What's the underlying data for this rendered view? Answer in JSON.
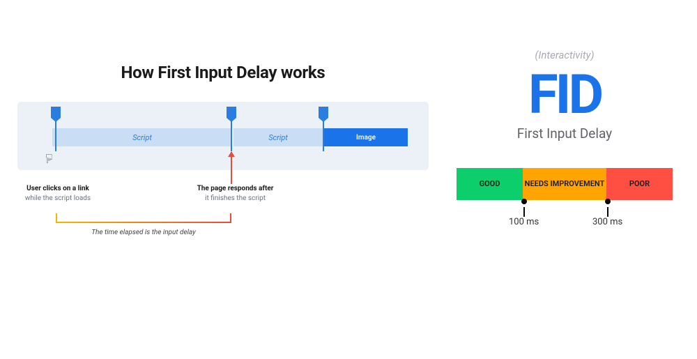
{
  "left": {
    "title": "How First Input Delay works",
    "segments": {
      "script1": "Script",
      "script2": "Script",
      "image": "Image"
    },
    "annotations": {
      "click_bold": "User clicks on a link",
      "click_sub": "while the script loads",
      "response_bold": "The page responds after",
      "response_sub": "it finishes the script",
      "elapsed": "The time elapsed is the input delay"
    }
  },
  "right": {
    "category": "(Interactivity)",
    "abbrev": "FID",
    "full": "First Input Delay",
    "scale": {
      "good": "GOOD",
      "needs": "NEEDS IMPROVEMENT",
      "poor": "POOR"
    },
    "thresholds": {
      "low": "100 ms",
      "high": "300 ms"
    }
  }
}
